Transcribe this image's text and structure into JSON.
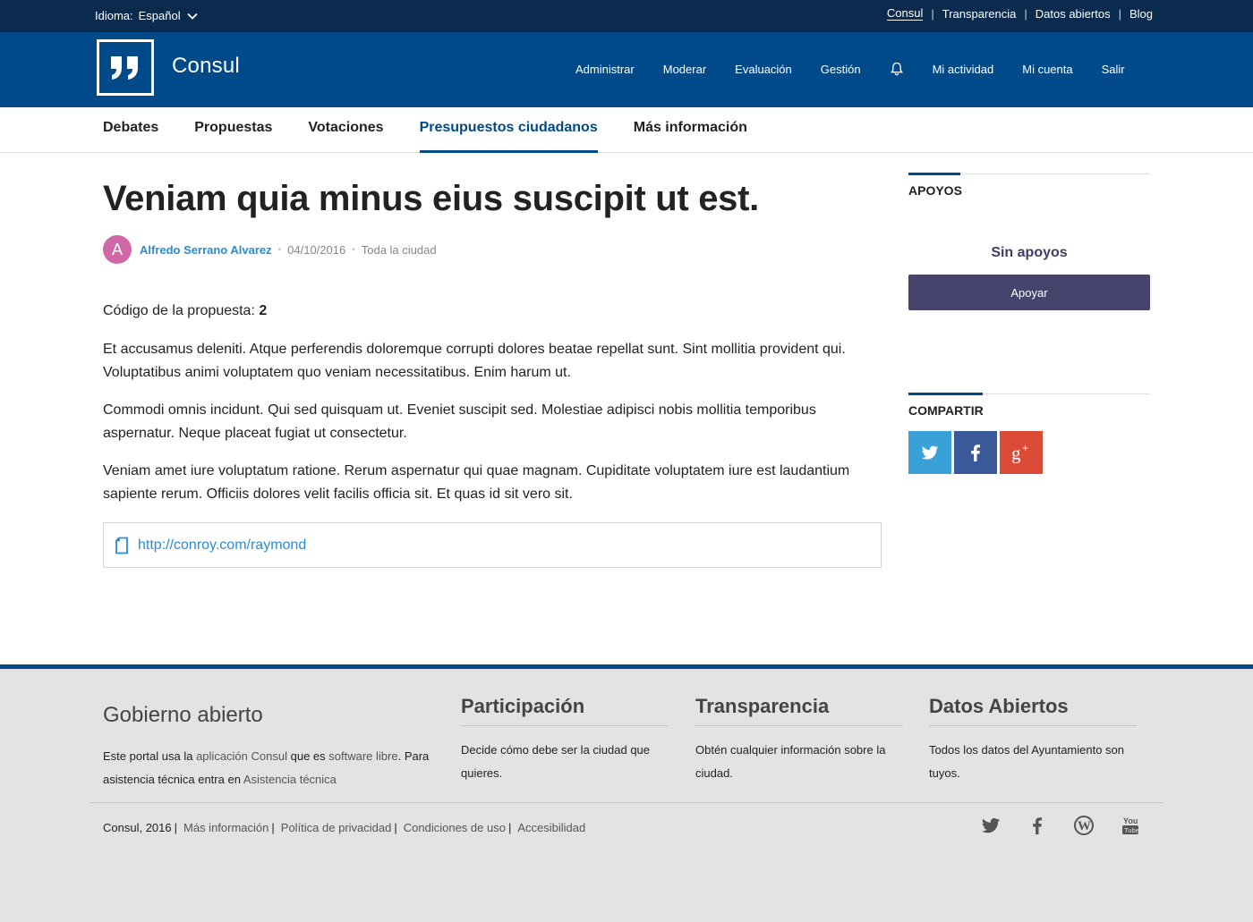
{
  "topbar": {
    "language_label": "Idioma:",
    "language_value": "Español",
    "links": [
      "Consul",
      "Transparencia",
      "Datos abiertos",
      "Blog"
    ]
  },
  "header": {
    "site_name": "Consul",
    "nav": {
      "admin": "Administrar",
      "moderate": "Moderar",
      "evaluation": "Evaluación",
      "management": "Gestión",
      "my_activity": "Mi actividad",
      "my_account": "Mi cuenta",
      "logout": "Salir"
    }
  },
  "subnav": {
    "debates": "Debates",
    "proposals": "Propuestas",
    "votes": "Votaciones",
    "budgets": "Presupuestos ciudadanos",
    "more_info": "Más información"
  },
  "investment": {
    "title": "Veniam quia minus eius suscipit ut est.",
    "author_initial": "A",
    "author": "Alfredo Serrano Alvarez",
    "date": "04/10/2016",
    "scope": "Toda la ciudad",
    "code_label": "Código de la propuesta:",
    "code_value": "2",
    "paragraphs": [
      "Et accusamus deleniti. Atque perferendis doloremque corrupti dolores beatae repellat sunt. Sint mollitia provident qui. Voluptatibus animi voluptatem quo veniam necessitatibus. Enim harum ut.",
      "Commodi omnis incidunt. Qui sed quisquam ut. Eveniet suscipit sed. Molestiae adipisci nobis mollitia temporibus aspernatur. Neque placeat fugiat ut consectetur.",
      "Veniam amet iure voluptatum ratione. Rerum aspernatur qui quae magnam. Cupiditate voluptatem iure est laudantium sapiente rerum. Officiis dolores velit facilis officia sit. Et quas id sit vero sit."
    ],
    "external_url": "http://conroy.com/raymond"
  },
  "sidebar": {
    "supports_heading": "APOYOS",
    "no_supports": "Sin apoyos",
    "support_button": "Apoyar",
    "share_heading": "COMPARTIR",
    "share_icons": [
      "twitter-icon",
      "facebook-icon",
      "google-plus-icon"
    ],
    "share_colors": {
      "twitter": "#3aa1d8",
      "facebook": "#3b5998",
      "google_plus": "#dc4a38"
    }
  },
  "footer": {
    "brand": "Gobierno abierto",
    "desc_prefix": "Este portal usa la",
    "desc_link1": "aplicación Consul",
    "desc_middle": "que es",
    "desc_link2": "software libre",
    "desc_after": ". Para asistencia técnica entra en",
    "desc_link3": "Asistencia técnica",
    "columns": [
      {
        "title": "Participación",
        "text": "Decide cómo debe ser la ciudad que quieres."
      },
      {
        "title": "Transparencia",
        "text": "Obtén cualquier información sobre la ciudad."
      },
      {
        "title": "Datos Abiertos",
        "text": "Todos los datos del Ayuntamiento son tuyos."
      }
    ],
    "copyright": "Consul, 2016",
    "bottom_links": [
      "Más información",
      "Política de privacidad",
      "Condiciones de uso",
      "Accesibilidad"
    ],
    "social_icons": [
      "twitter-icon",
      "facebook-icon",
      "wordpress-icon",
      "youtube-icon"
    ]
  },
  "colors": {
    "topbar": "#0b2b4e",
    "header": "#004a8a",
    "support_button": "#46436d",
    "avatar": "#d267a7",
    "link": "#2a8bd8"
  }
}
